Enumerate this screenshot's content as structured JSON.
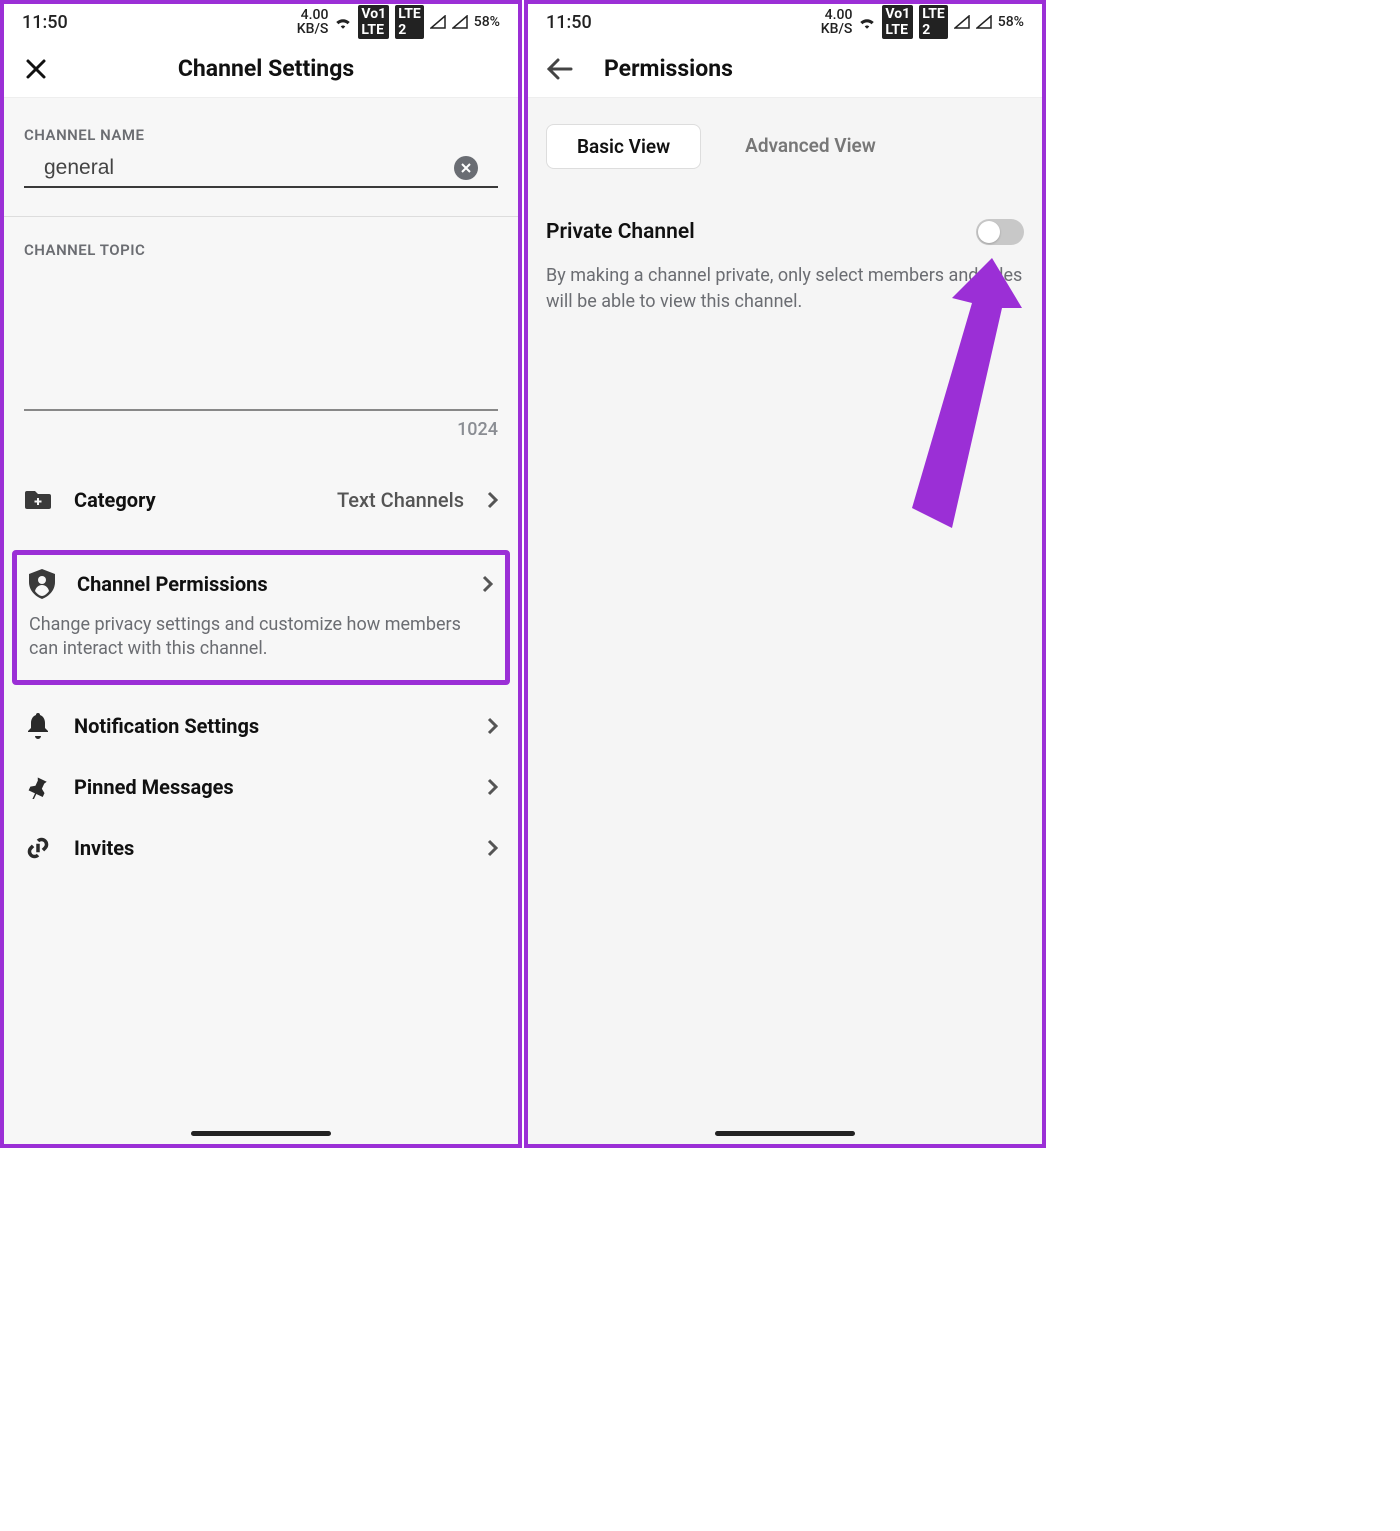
{
  "status": {
    "time": "11:50",
    "kbps": "4.00",
    "kbps_unit": "KB/S",
    "lte1": "Vo1 LTE",
    "lte2": "LTE 2",
    "battery": "58%"
  },
  "left": {
    "title": "Channel Settings",
    "channel_name_label": "CHANNEL NAME",
    "channel_name_value": "general",
    "channel_topic_label": "CHANNEL TOPIC",
    "topic_counter": "1024",
    "category": {
      "label": "Category",
      "value": "Text Channels"
    },
    "permissions": {
      "label": "Channel Permissions",
      "desc": "Change privacy settings and customize how members can interact with this channel."
    },
    "rows": {
      "notifications": "Notification Settings",
      "pinned": "Pinned Messages",
      "invites": "Invites"
    }
  },
  "right": {
    "title": "Permissions",
    "tabs": {
      "basic": "Basic View",
      "advanced": "Advanced View"
    },
    "private_label": "Private Channel",
    "private_desc": "By making a channel private, only select members and roles will be able to view this channel."
  }
}
